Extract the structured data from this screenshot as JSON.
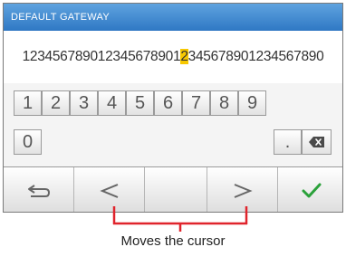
{
  "window": {
    "title": "DEFAULT GATEWAY"
  },
  "field": {
    "before": "123456789012345678901",
    "cursor_char": "2",
    "after": "345678901234567890"
  },
  "keypad": {
    "row1": [
      "1",
      "2",
      "3",
      "4",
      "5",
      "6",
      "7",
      "8",
      "9"
    ],
    "zero": "0",
    "dot": ".",
    "delete_icon": "backspace-icon"
  },
  "toolbar": {
    "back_icon": "return-icon",
    "left_label": "<",
    "right_label": ">",
    "confirm_icon": "checkmark-icon"
  },
  "annotation": {
    "text": "Moves the cursor"
  },
  "colors": {
    "title_bar": "#3a86d0",
    "cursor_highlight": "#f7c800",
    "confirm": "#2aa13a",
    "bracket": "#e0242c"
  }
}
